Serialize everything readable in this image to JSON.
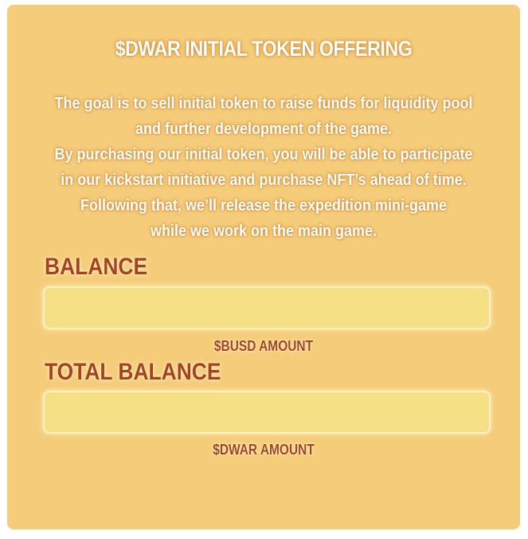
{
  "ito": {
    "title": "$DWAR INITIAL TOKEN OFFERING",
    "description_lines": [
      "The goal is to sell initial token to raise funds for liquidity pool",
      "and further development of the game.",
      "By purchasing our initial token, you will be able to participate",
      "in our kickstart initiative and purchase NFT’s ahead of time.",
      "Following that, we’ll release the expedition mini-game",
      "while we work on the main game."
    ],
    "balance": {
      "label": "BALANCE",
      "value": "",
      "placeholder": "",
      "caption": "$BUSD AMOUNT"
    },
    "total_balance": {
      "label": "TOTAL BALANCE",
      "value": "",
      "placeholder": "",
      "caption": "$DWAR AMOUNT"
    }
  },
  "colors": {
    "card_background": "#f5cd7a",
    "input_background": "#f5e085",
    "label_color": "#a8421a",
    "title_color": "#ffffff"
  }
}
